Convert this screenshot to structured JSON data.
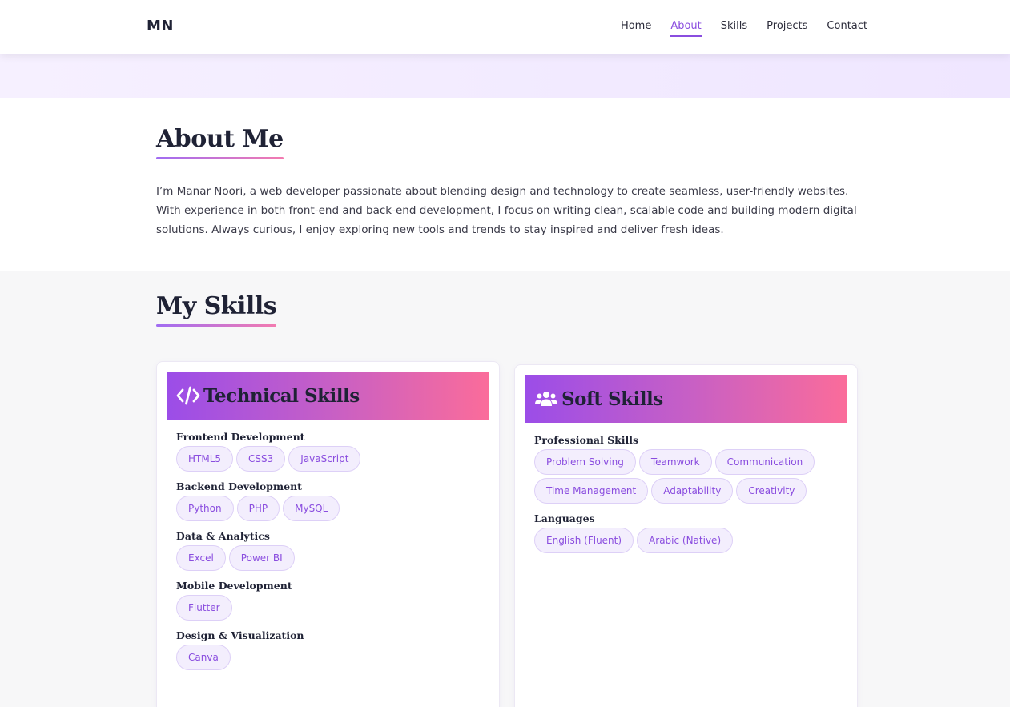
{
  "header": {
    "logo": "MN",
    "nav": [
      {
        "label": "Home",
        "active": false
      },
      {
        "label": "About",
        "active": true
      },
      {
        "label": "Skills",
        "active": false
      },
      {
        "label": "Projects",
        "active": false
      },
      {
        "label": "Contact",
        "active": false
      }
    ]
  },
  "about": {
    "title": "About Me",
    "text": "I’m Manar Noori, a web developer passionate about blending design and technology to create seamless, user-friendly websites. With experience in both front-end and back-end development, I focus on writing clean, scalable code and building modern digital solutions. Always curious, I enjoy exploring new tools and trends to stay inspired and deliver fresh ideas."
  },
  "skills": {
    "title": "My Skills",
    "technical": {
      "title": "Technical Skills",
      "icon": "code-icon",
      "groups": [
        {
          "label": "Frontend Development",
          "tags": [
            "HTML5",
            "CSS3",
            "JavaScript"
          ]
        },
        {
          "label": "Backend Development",
          "tags": [
            "Python",
            "PHP",
            "MySQL"
          ]
        },
        {
          "label": "Data & Analytics",
          "tags": [
            "Excel",
            "Power BI"
          ]
        },
        {
          "label": "Mobile Development",
          "tags": [
            "Flutter"
          ]
        },
        {
          "label": "Design & Visualization",
          "tags": [
            "Canva"
          ]
        }
      ]
    },
    "soft": {
      "title": "Soft Skills",
      "icon": "users-icon",
      "groups": [
        {
          "label": "Professional Skills",
          "tags": [
            "Problem Solving",
            "Teamwork",
            "Communication",
            "Time Management",
            "Adaptability",
            "Creativity"
          ]
        },
        {
          "label": "Languages",
          "tags": [
            "English (Fluent)",
            "Arabic (Native)"
          ]
        }
      ]
    }
  },
  "colors": {
    "accent": "#8a4ddf",
    "gradient_start": "#9b4de8",
    "gradient_end": "#fb6c9a",
    "tag_bg": "#f3eefd"
  }
}
